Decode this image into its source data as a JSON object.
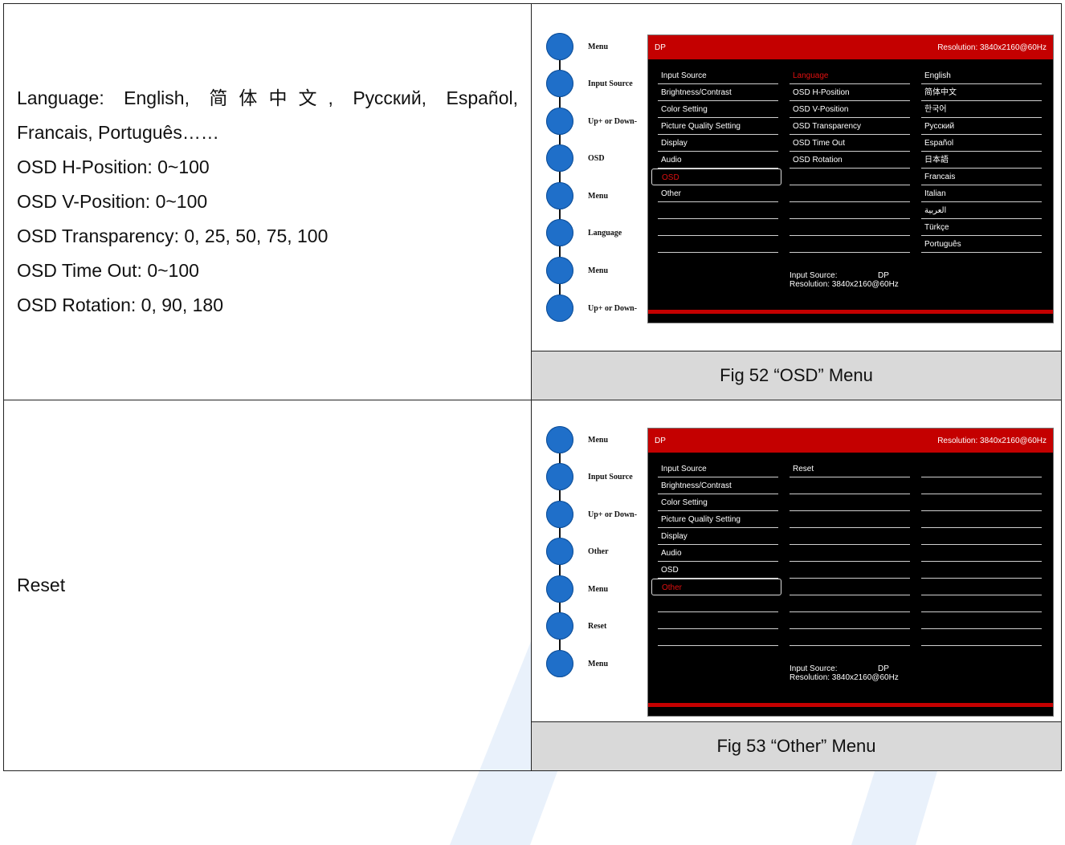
{
  "rows": [
    {
      "description": [
        "Language: English, 简体中文, Русский, Español,",
        "Francais, Português……",
        "OSD H-Position: 0~100",
        "OSD V-Position: 0~100",
        "OSD Transparency: 0, 25, 50, 75, 100",
        "OSD Time Out: 0~100",
        "OSD Rotation: 0, 90, 180"
      ],
      "flow": [
        "Menu",
        "Input Source",
        "Up+ or Down-",
        "OSD",
        "Menu",
        "Language",
        "Menu",
        "Up+ or Down-"
      ],
      "osd": {
        "source": "DP",
        "resolution": "Resolution:  3840x2160@60Hz",
        "col1": [
          "Input Source",
          "Brightness/Contrast",
          "Color Setting",
          "Picture Quality Setting",
          "Display",
          "Audio",
          "OSD",
          "Other",
          "",
          "",
          ""
        ],
        "col2": [
          "Language",
          "OSD H-Position",
          "OSD V-Position",
          "OSD Transparency",
          "OSD Time Out",
          "OSD Rotation",
          "",
          "",
          "",
          "",
          ""
        ],
        "col3": [
          "English",
          "简体中文",
          "한국어",
          "Русский",
          "Español",
          "日本語",
          "Francais",
          "Italian",
          "العربية",
          "Türkçe",
          "Português"
        ],
        "info_source_label": "Input Source:",
        "info_source_value": "DP",
        "info_resolution": "Resolution:  3840x2160@60Hz"
      },
      "caption": "Fig 52 “OSD” Menu"
    },
    {
      "description": [
        "Reset"
      ],
      "flow": [
        "Menu",
        "Input Source",
        "Up+ or Down-",
        "Other",
        "Menu",
        "Reset",
        "Menu"
      ],
      "osd": {
        "source": "DP",
        "resolution": "Resolution:  3840x2160@60Hz",
        "col1": [
          "Input Source",
          "Brightness/Contrast",
          "Color Setting",
          "Picture Quality Setting",
          "Display",
          "Audio",
          "OSD",
          "Other",
          "",
          "",
          ""
        ],
        "col2": [
          "Reset",
          "",
          "",
          "",
          "",
          "",
          "",
          "",
          "",
          "",
          ""
        ],
        "col3": [
          "",
          "",
          "",
          "",
          "",
          "",
          "",
          "",
          "",
          "",
          ""
        ],
        "info_source_label": "Input Source:",
        "info_source_value": "DP",
        "info_resolution": "Resolution:  3840x2160@60Hz"
      },
      "caption": "Fig 53 “Other” Menu"
    }
  ],
  "colors": {
    "osd_bar": "#c40000",
    "flow_circle": "#1f6fc9",
    "caption_bg": "#d9d9d9"
  }
}
